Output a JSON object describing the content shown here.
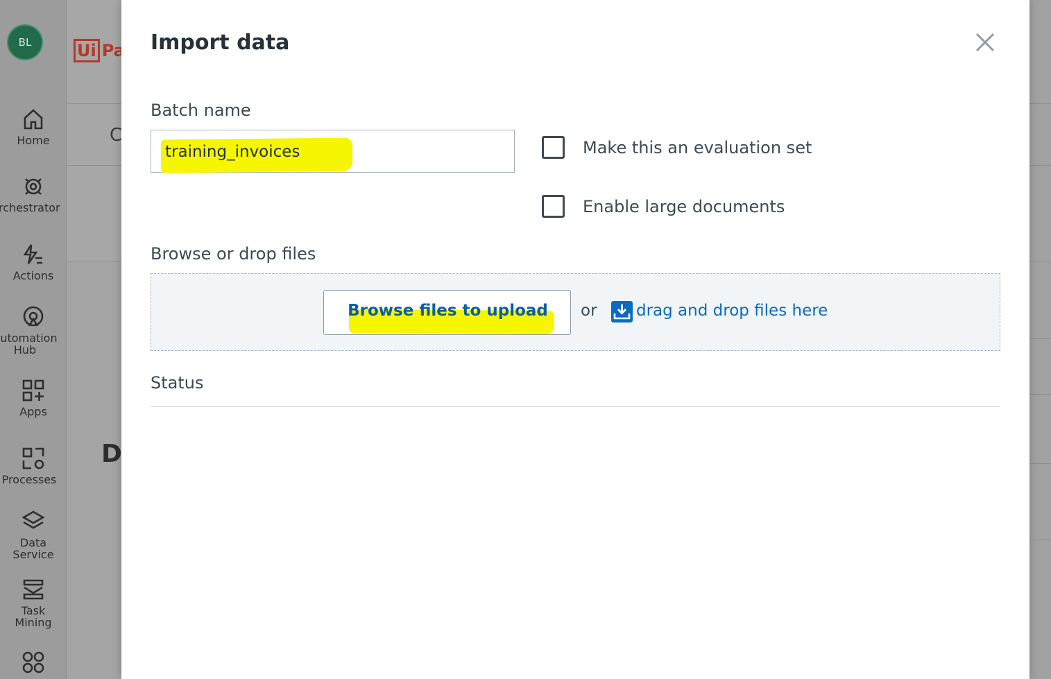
{
  "sidebar": {
    "avatar_initials": "BL",
    "items": [
      {
        "label": "Home",
        "icon": "home-icon"
      },
      {
        "label": "Orchestrator",
        "icon": "orchestrator-icon"
      },
      {
        "label": "Actions",
        "icon": "actions-icon"
      },
      {
        "label": "Automation Hub",
        "icon": "automation-hub-icon"
      },
      {
        "label": "Apps",
        "icon": "apps-icon"
      },
      {
        "label": "Processes",
        "icon": "processes-icon"
      },
      {
        "label": "Data Service",
        "icon": "data-service-icon"
      },
      {
        "label": "Task Mining",
        "icon": "task-mining-icon"
      },
      {
        "label": "",
        "icon": "more-apps-icon"
      }
    ]
  },
  "background": {
    "logo_box": "Ui",
    "logo_rest": "Pa",
    "letter_c": "C",
    "letter_d": "D"
  },
  "modal": {
    "title": "Import data",
    "batch_name_label": "Batch name",
    "batch_name_value": "training_invoices",
    "eval_checkbox_label": "Make this an evaluation set",
    "large_docs_checkbox_label": "Enable large documents",
    "browse_label": "Browse or drop files",
    "browse_button": "Browse files to upload",
    "or_text": "or",
    "drag_drop_link": "drag and drop files here",
    "status_label": "Status"
  },
  "colors": {
    "highlight": "#f6f600",
    "link": "#0b6bc1",
    "avatar": "#1f6b4c",
    "logo": "#b23b2a"
  }
}
